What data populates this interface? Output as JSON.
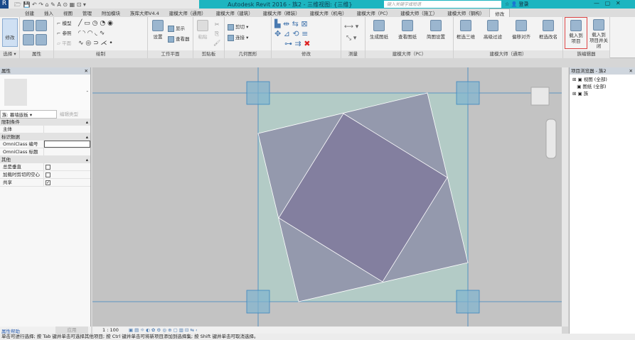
{
  "title_bar": {
    "title": "Autodesk Revit 2016 -  族2 - 三维视图: {三维}",
    "search_placeholder": "键入关键字或短语",
    "login": "登录"
  },
  "tabs": [
    "创建",
    "插入",
    "视图",
    "管理",
    "附加模块",
    "族库大师V4.4",
    "建模大师（通用）",
    "建模大师（建筑）",
    "建模大师（精装）",
    "建模大师（机电）",
    "建模大师（PC）",
    "建模大师（施工）",
    "建模大师（钢构）",
    "修改"
  ],
  "active_tab": "修改",
  "ribbon": {
    "select": {
      "modify": "修改",
      "label": "选择 ▾"
    },
    "properties": {
      "label": "属性"
    },
    "draw": {
      "model": "模型",
      "ref": "参照",
      "plane": "平面",
      "label": "绘制"
    },
    "workplane": {
      "set": "设置",
      "show": "显示",
      "viewer": "查看器",
      "label": "工作平面"
    },
    "clipboard": {
      "paste": "粘贴",
      "label": "剪贴板"
    },
    "geometry": {
      "cut": "剪切",
      "join": "连接",
      "label": "几何图形"
    },
    "modify": {
      "label": "修改"
    },
    "measure": {
      "label": "测量"
    },
    "pc": {
      "items": [
        "生成图纸",
        "查看图纸",
        "简图设置"
      ],
      "label": "建模大师（PC）"
    },
    "general": {
      "items": [
        "框选三维",
        "高级过滤",
        "偏移对齐",
        "框选改名"
      ],
      "label": "建模大师（通用）"
    },
    "family_editor": {
      "load": "载入到\n项目",
      "load_close": "载入到\n项目并关闭",
      "label": "族编辑器"
    }
  },
  "properties": {
    "title": "属性",
    "type_selector": "族: 幕墙嵌板",
    "edit_type": "编辑类型",
    "sections": [
      {
        "name": "限制条件",
        "rows": [
          {
            "k": "主体",
            "v": ""
          }
        ]
      },
      {
        "name": "标识数据",
        "rows": [
          {
            "k": "OmniClass 编号",
            "v": ""
          },
          {
            "k": "OmniClass 标题",
            "v": ""
          }
        ]
      },
      {
        "name": "其他",
        "rows": [
          {
            "k": "总是垂直",
            "v": "☐"
          },
          {
            "k": "加载时剪切的空心",
            "v": "☐"
          },
          {
            "k": "共享",
            "v": "☑"
          }
        ]
      }
    ],
    "help": "属性帮助",
    "apply": "应用"
  },
  "browser": {
    "title": "项目浏览器 - 族2",
    "items": [
      "视图 (全部)",
      "图纸 (全部)",
      "族"
    ]
  },
  "view_bar": {
    "scale": "1 : 100"
  },
  "status": "单击可进行选择; 按 Tab 键并单击可选择其他项目; 按 Ctrl 键并单击可将新项目添加到选择集; 按 Shift 键并单击可取消选择。"
}
